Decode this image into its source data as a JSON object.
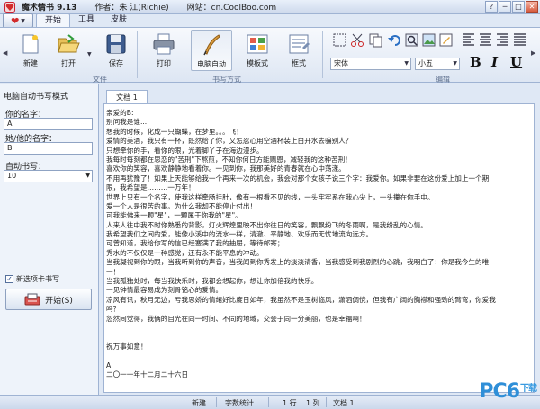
{
  "window": {
    "title": "魔术情书 9.13",
    "author": "作者：朱 江(Richie)",
    "website": "网站：cn.CoolBoo.com",
    "controls": [
      "?",
      "─",
      "□",
      "✕"
    ]
  },
  "tabs": [
    {
      "label": "开始"
    },
    {
      "label": "工具"
    },
    {
      "label": "皮肤"
    }
  ],
  "ribbon": {
    "groups": {
      "file": "文件",
      "write_mode": "书写方式",
      "edit": "编辑"
    },
    "buttons": {
      "new": "新建",
      "open": "打开",
      "save": "保存",
      "print": "打印",
      "auto_write": "电脑自动",
      "template": "模板式",
      "frame": "框式"
    },
    "font_name": "宋体",
    "font_size": "小五",
    "format": {
      "bold": "B",
      "italic": "I",
      "underline": "U"
    }
  },
  "left_panel": {
    "title": "电脑自动书写模式",
    "your_name_label": "你的名字：",
    "your_name_value": "A",
    "partner_name_label": "她/他的名字：",
    "partner_name_value": "B",
    "speed_label": "自动书写：",
    "speed_value": "10",
    "new_tab_label": "新选项卡书写",
    "start_label": "开始(S)"
  },
  "document": {
    "tab": "文档 1",
    "lines": [
      "亲爱的B:",
      "      别问我是谁...",
      "想我的时候，化成一只蝴蝶，在梦里。。。飞！",
      "爱情的美酒，我只有一杯，既然给了你，又怎忍心用空酒杯装上白开水去骗别人？",
      "只想牵你的手，看你的眼，光着脚丫子在海边漫步。",
      "我每时每刻都在思恋的\"苦刑\"下熬煎，不知你何日方能赐恩，减轻我的这种苦刑！",
      "喜欢你的笑容，喜欢静静地看着你。一见到你，我那美好的青春就在心中荡漾。",
      "不用再犹豫了！如果上天能够给我一个再来一次的机会，我会对那个女孩子说三个字：我爱你。如果非要在这份爱上加上一个期",
      "限，我希望是………一万年！",
      "世界上只有一个名字，使我这样牵肠挂肚，像有一根看不见的线，一头牢牢系在我心尖上，一头攥在你手中。",
      "爱一个人是很苦的事。为什么我却不能停止付出！",
      "可我能佛来一颗\"星\"，一颗属于你我的\"星\"。",
      "人来人往中我不时你熟悉的背影，灯火辉煌里映不出你往日的笑容，飘飘纷飞的冬雨啊，是我纷乱的心情。",
      "我希望我们之间的爱，能像小溪中的流水一样，清澈、平静地、欢乐而无忧地流向远方。",
      "可曾知道，我给你写的信已经塞满了我的抽屉，等待邮寄；",
      "秀水的不仅仅是一种感觉，还有永不能平息的冲动。",
      "当我凝视到你的眼，当我听到你的声音，当我闻到你秀发上的淡淡清香，当我感受到我剧烈的心跳，我明白了：你是我今生的唯",
      "一！",
      "当我孤独处时，每当我快乐时，我都会想起你，想让你加倍我的快乐。",
      "一见钟情最容易成为刻骨铭心的爱情。",
      "凉风有讯，秋月无边，亏我思娇的情绪好比度日如年，我虽然不是玉树临风，潇洒倜傥，但我有广阔的胸襟和强劲的臂弯，你爱我",
      "吗？",
      "忽然间觉得，我俩的目光在同一时间、不同的地域，交会于同一分美丽，也是幸福啊！",
      "",
      "",
      "      祝万事如意！",
      "",
      "                                    A",
      "                                  二〇一一年十二月二十六日"
    ]
  },
  "status": {
    "new": "新建",
    "word_count": "字数统计",
    "row": "1 行",
    "col": "1 列",
    "doc": "文档 1"
  },
  "watermark": {
    "text": "PC6",
    "sub": "下载"
  },
  "colors": {
    "accent": "#2f8fd8",
    "chrome": "#dfe8f5",
    "border": "#9fb3d3"
  }
}
